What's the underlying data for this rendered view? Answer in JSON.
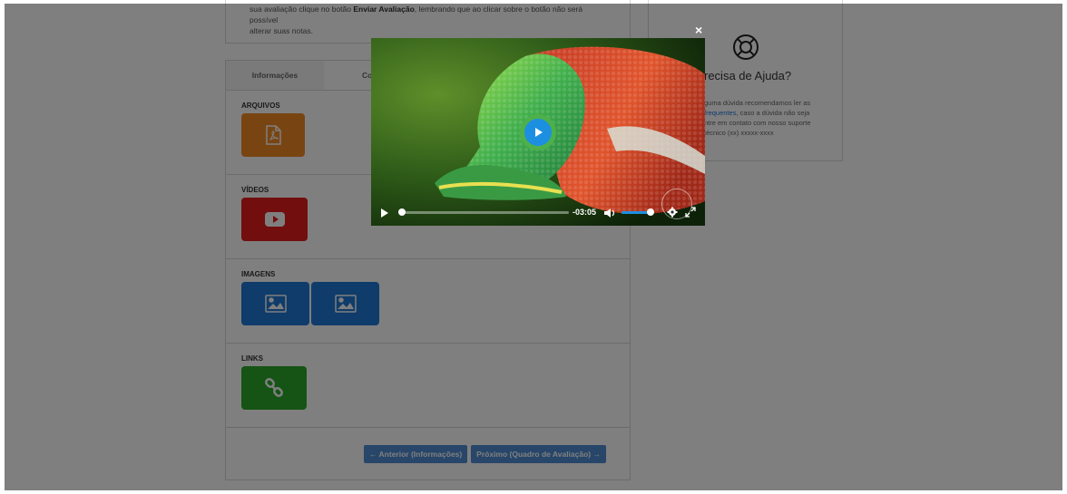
{
  "intro": {
    "line1_prefix": "sua avaliação clique no botão ",
    "line1_bold": "Enviar Avaliação",
    "line1_suffix": ", lembrando que ao clicar sobre o botão não será possível",
    "line2": "alterar suas notas."
  },
  "tabs": [
    {
      "label": "Informações"
    },
    {
      "label": "Conte"
    }
  ],
  "sections": {
    "arquivos": "ARQUIVOS",
    "videos": "VÍDEOS",
    "imagens": "IMAGENS",
    "links": "LINKS"
  },
  "nav": {
    "prev": "← Anterior (Informações)",
    "next": "Próximo (Quadro de Avaliação) →"
  },
  "help": {
    "title": "recisa de Ajuda?",
    "text_1": "guma dúvida recomendamos ler as",
    "text_link": "frequentes",
    "text_2": ", caso a dúvida não seja",
    "text_3": "ntre em contato com nosso suporte",
    "text_4": "técnico (xx) xxxxx-xxxx"
  },
  "player": {
    "time_remaining": "-03:05",
    "progress": 0.0,
    "volume": 1.0,
    "close_label": "×"
  },
  "colors": {
    "orange": "#f08a24",
    "red": "#e41d1d",
    "blue": "#1e78d4",
    "green": "#2ba82b",
    "accent": "#1d8fe1"
  }
}
